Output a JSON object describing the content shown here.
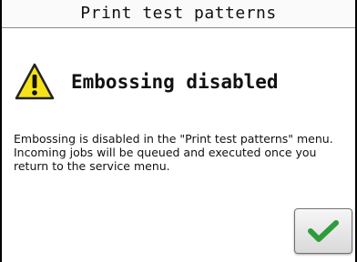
{
  "dialog": {
    "title": "Print test patterns",
    "heading": "Embossing disabled",
    "message": "Embossing is disabled in the \"Print test patterns\" menu. Incoming jobs will be queued and executed once you return to the service menu.",
    "warning_icon": "warning-triangle-icon",
    "ok_icon": "checkmark-icon"
  },
  "colors": {
    "warning_fill": "#f5e21a",
    "checkmark": "#2e9b3c",
    "button_border": "#6f6f6f"
  }
}
